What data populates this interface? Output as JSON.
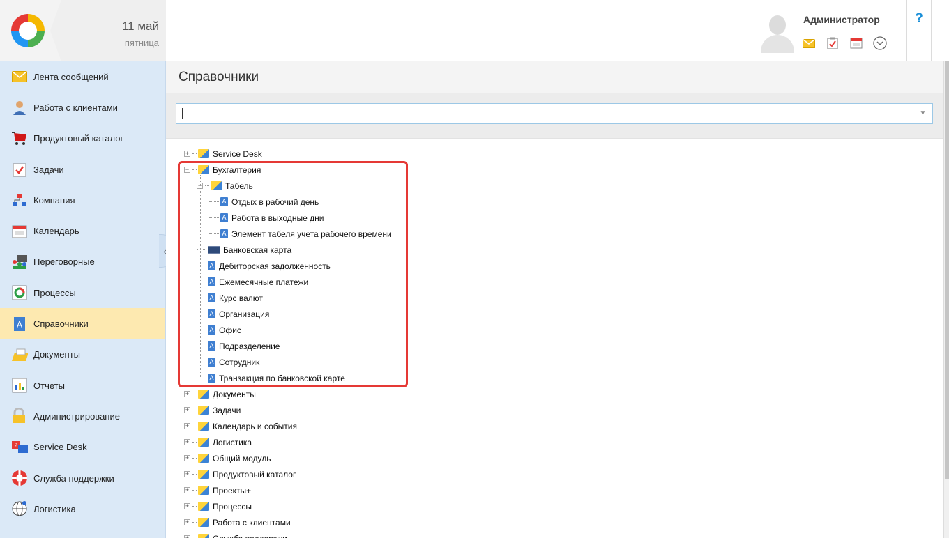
{
  "header": {
    "date_day": "11 май",
    "date_weekday": "пятница",
    "user_name": "Администратор",
    "help_label": "?"
  },
  "sidebar": {
    "items": [
      {
        "label": "Лента сообщений",
        "icon": "mail-icon"
      },
      {
        "label": "Работа с клиентами",
        "icon": "client-icon"
      },
      {
        "label": "Продуктовый каталог",
        "icon": "cart-icon"
      },
      {
        "label": "Задачи",
        "icon": "task-icon"
      },
      {
        "label": "Компания",
        "icon": "org-chart-icon"
      },
      {
        "label": "Календарь",
        "icon": "calendar-icon"
      },
      {
        "label": "Переговорные",
        "icon": "meeting-icon"
      },
      {
        "label": "Процессы",
        "icon": "process-icon"
      },
      {
        "label": "Справочники",
        "icon": "directory-icon"
      },
      {
        "label": "Документы",
        "icon": "documents-icon"
      },
      {
        "label": "Отчеты",
        "icon": "reports-icon"
      },
      {
        "label": "Администрирование",
        "icon": "lock-icon"
      },
      {
        "label": "Service Desk",
        "icon": "service-desk-icon"
      },
      {
        "label": "Служба поддержки",
        "icon": "lifebuoy-icon"
      },
      {
        "label": "Логистика",
        "icon": "globe-icon"
      }
    ],
    "active_index": 8
  },
  "main": {
    "page_title": "Справочники",
    "search_value": ""
  },
  "tree": {
    "top_before": [
      {
        "label": "Service Desk"
      }
    ],
    "accounting": {
      "label": "Бухгалтерия",
      "timesheet": {
        "label": "Табель",
        "children": [
          "Отдых в рабочий день",
          "Работа в выходные дни",
          "Элемент табеля учета рабочего времени"
        ]
      },
      "children": [
        "Банковская карта",
        "Дебиторская задолженность",
        "Ежемесячные платежи",
        "Курс валют",
        "Организация",
        "Офис",
        "Подразделение",
        "Сотрудник",
        "Транзакция по банковской карте"
      ]
    },
    "top_after": [
      "Документы",
      "Задачи",
      "Календарь и события",
      "Логистика",
      "Общий модуль",
      "Продуктовый каталог",
      "Проекты+",
      "Процессы",
      "Работа с клиентами",
      "Служба поддержки"
    ]
  },
  "colors": {
    "sidebar_bg": "#dbe9f7",
    "active_bg": "#fde9b0",
    "highlight": "#e53935",
    "accent": "#1a8fd8"
  }
}
